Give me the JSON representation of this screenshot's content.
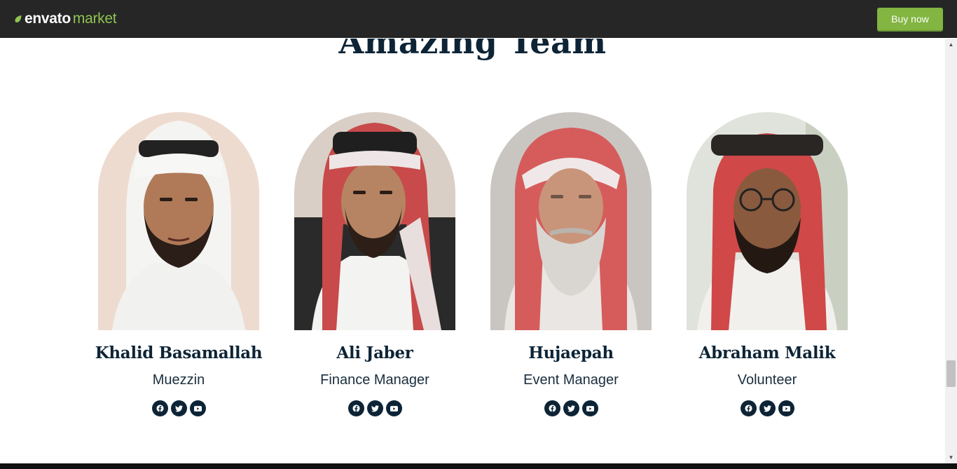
{
  "topbar": {
    "logo_envato": "envato",
    "logo_market": "market",
    "buy_label": "Buy now",
    "brand_color": "#82b541"
  },
  "section": {
    "heading": "Amazing Team"
  },
  "team": [
    {
      "name": "Khalid Basamallah",
      "role": "Muezzin",
      "socials": [
        "facebook-icon",
        "twitter-icon",
        "youtube-icon"
      ]
    },
    {
      "name": "Ali Jaber",
      "role": "Finance Manager",
      "socials": [
        "facebook-icon",
        "twitter-icon",
        "youtube-icon"
      ]
    },
    {
      "name": "Hujaepah",
      "role": "Event Manager",
      "socials": [
        "facebook-icon",
        "twitter-icon",
        "youtube-icon"
      ]
    },
    {
      "name": "Abraham Malik",
      "role": "Volunteer",
      "socials": [
        "facebook-icon",
        "twitter-icon",
        "youtube-icon"
      ]
    }
  ],
  "colors": {
    "navy": "#0d2436",
    "topbar": "#262626"
  }
}
